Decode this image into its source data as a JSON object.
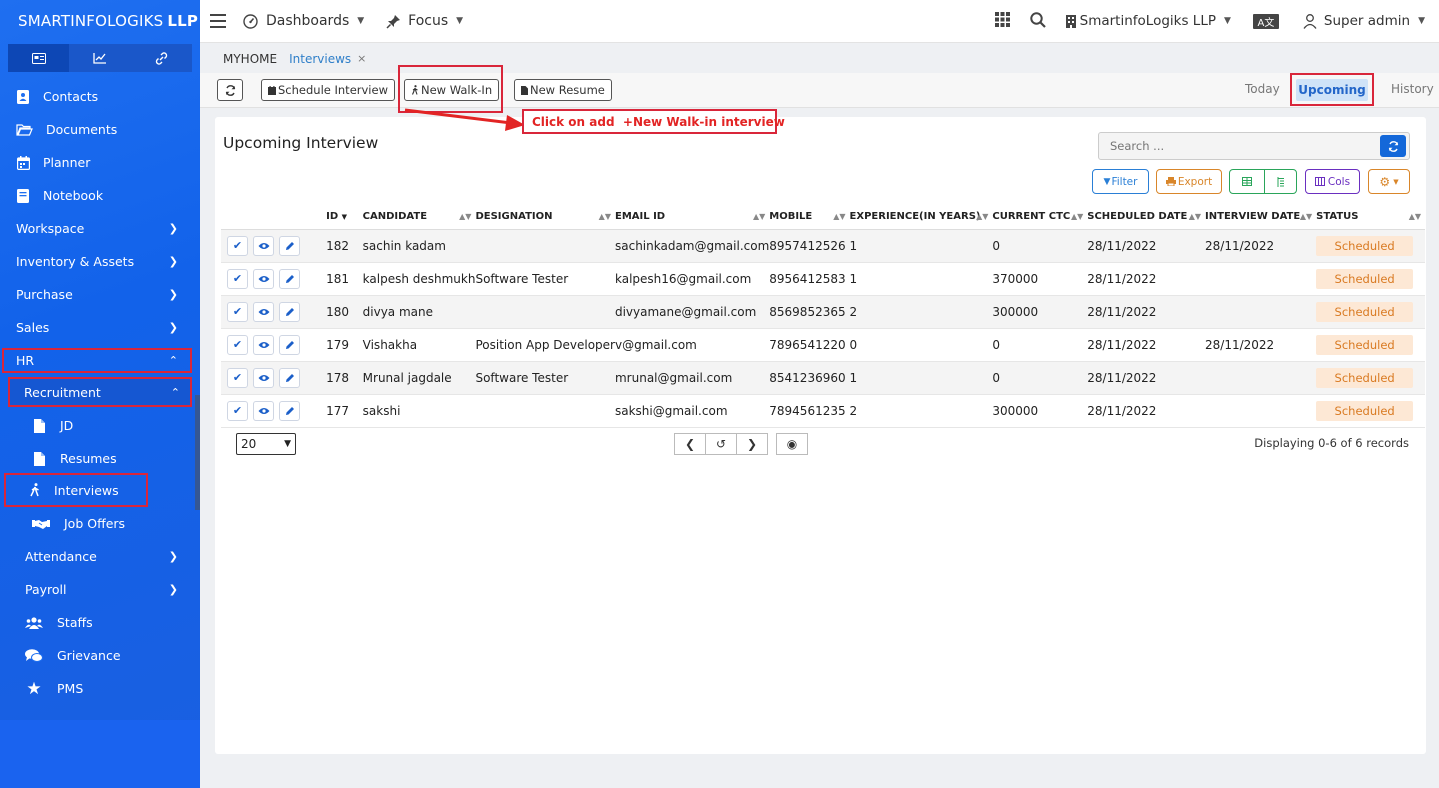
{
  "brand": {
    "name": "SMARTINFOLOGIKS",
    "suffix": "LLP"
  },
  "topbar": {
    "dashboards": "Dashboards",
    "focus": "Focus",
    "company": "SmartinfoLogiks LLP",
    "lang": "A文",
    "user": "Super admin"
  },
  "sidebar": {
    "items": [
      {
        "label": "Contacts"
      },
      {
        "label": "Documents"
      },
      {
        "label": "Planner"
      },
      {
        "label": "Notebook"
      },
      {
        "label": "Workspace"
      },
      {
        "label": "Inventory & Assets"
      },
      {
        "label": "Purchase"
      },
      {
        "label": "Sales"
      },
      {
        "label": "HR"
      },
      {
        "label": "Recruitment"
      },
      {
        "label": "JD"
      },
      {
        "label": "Resumes"
      },
      {
        "label": "Interviews"
      },
      {
        "label": "Job Offers"
      },
      {
        "label": "Attendance"
      },
      {
        "label": "Payroll"
      },
      {
        "label": "Staffs"
      },
      {
        "label": "Grievance"
      },
      {
        "label": "PMS"
      }
    ]
  },
  "breadcrumb": {
    "home": "MYHOME",
    "current": "Interviews",
    "close": "×"
  },
  "toolbar": {
    "schedule": "Schedule Interview",
    "walkin": "New Walk-In",
    "resume": "New Resume",
    "today": "Today",
    "upcoming": "Upcoming",
    "history": "History"
  },
  "annotation": {
    "text": "Click on add  +New Walk-in interview"
  },
  "card": {
    "title": "Upcoming Interview",
    "search_placeholder": "Search ...",
    "filter": "Filter",
    "export": "Export",
    "cols": "Cols"
  },
  "table": {
    "headers": [
      "ID",
      "CANDIDATE",
      "DESIGNATION",
      "EMAIL ID",
      "MOBILE",
      "EXPERIENCE(IN YEARS)",
      "CURRENT CTC",
      "SCHEDULED DATE",
      "INTERVIEW DATE",
      "STATUS"
    ],
    "rows": [
      {
        "id": "182",
        "candidate": "sachin kadam",
        "designation": "",
        "email": "sachinkadam@gmail.com",
        "mobile": "8957412526",
        "exp": "1",
        "ctc": "0",
        "scheduled": "28/11/2022",
        "interview": "28/11/2022",
        "status": "Scheduled"
      },
      {
        "id": "181",
        "candidate": "kalpesh deshmukh",
        "designation": "Software Tester",
        "email": "kalpesh16@gmail.com",
        "mobile": "8956412583",
        "exp": "1",
        "ctc": "370000",
        "scheduled": "28/11/2022",
        "interview": "",
        "status": "Scheduled"
      },
      {
        "id": "180",
        "candidate": "divya mane",
        "designation": "",
        "email": "divyamane@gmail.com",
        "mobile": "8569852365",
        "exp": "2",
        "ctc": "300000",
        "scheduled": "28/11/2022",
        "interview": "",
        "status": "Scheduled"
      },
      {
        "id": "179",
        "candidate": "Vishakha",
        "designation": "Position App Developer",
        "email": "v@gmail.com",
        "mobile": "7896541220",
        "exp": "0",
        "ctc": "0",
        "scheduled": "28/11/2022",
        "interview": "28/11/2022",
        "status": "Scheduled"
      },
      {
        "id": "178",
        "candidate": "Mrunal jagdale",
        "designation": "Software Tester",
        "email": "mrunal@gmail.com",
        "mobile": "8541236960",
        "exp": "1",
        "ctc": "0",
        "scheduled": "28/11/2022",
        "interview": "",
        "status": "Scheduled"
      },
      {
        "id": "177",
        "candidate": "sakshi",
        "designation": "",
        "email": "sakshi@gmail.com",
        "mobile": "7894561235",
        "exp": "2",
        "ctc": "300000",
        "scheduled": "28/11/2022",
        "interview": "",
        "status": "Scheduled"
      }
    ]
  },
  "footer": {
    "page_size": "20",
    "display": "Displaying 0-6 of 6 records"
  },
  "colors": {
    "sidebar": "#1f6ff0",
    "highlight": "#d9263a",
    "status_bg": "#fde8d5",
    "status_fg": "#d97a22",
    "primary": "#1468d9"
  }
}
